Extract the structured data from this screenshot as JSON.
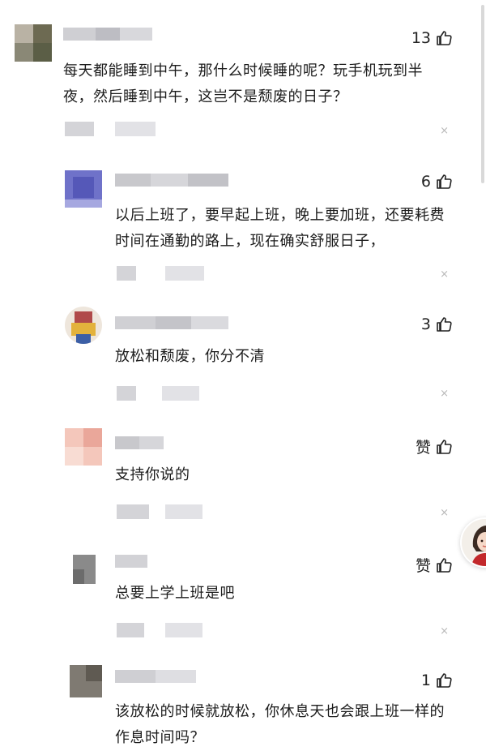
{
  "comments": [
    {
      "likes": "13",
      "text": "每天都能睡到中午，那什么时候睡的呢？玩手机玩到半夜，然后睡到中午，这岂不是颓废的日子？",
      "close_glyph": "×",
      "icon": "thumbs-up-icon"
    },
    {
      "likes": "6",
      "text": "以后上班了，要早起上班，晚上要加班，还要耗费时间在通勤的路上，现在确实舒服日子，",
      "close_glyph": "×",
      "icon": "thumbs-up-icon"
    },
    {
      "likes": "3",
      "text": "放松和颓废，你分不清",
      "close_glyph": "×",
      "icon": "thumbs-up-icon"
    },
    {
      "likes": "赞",
      "text": "支持你说的",
      "close_glyph": "×",
      "icon": "thumbs-up-icon"
    },
    {
      "likes": "赞",
      "text": "总要上学上班是吧",
      "close_glyph": "×",
      "icon": "thumbs-up-icon"
    },
    {
      "likes": "1",
      "text": "该放松的时候就放松，你休息天也会跟上班一样的作息时间吗？",
      "close_glyph": "",
      "icon": "thumbs-up-icon"
    }
  ],
  "colors": {
    "like_icon": "#222222",
    "close": "#b8b8b8",
    "floating_avatar_hair": "#3a2a22",
    "floating_avatar_shirt": "#c2282b"
  }
}
